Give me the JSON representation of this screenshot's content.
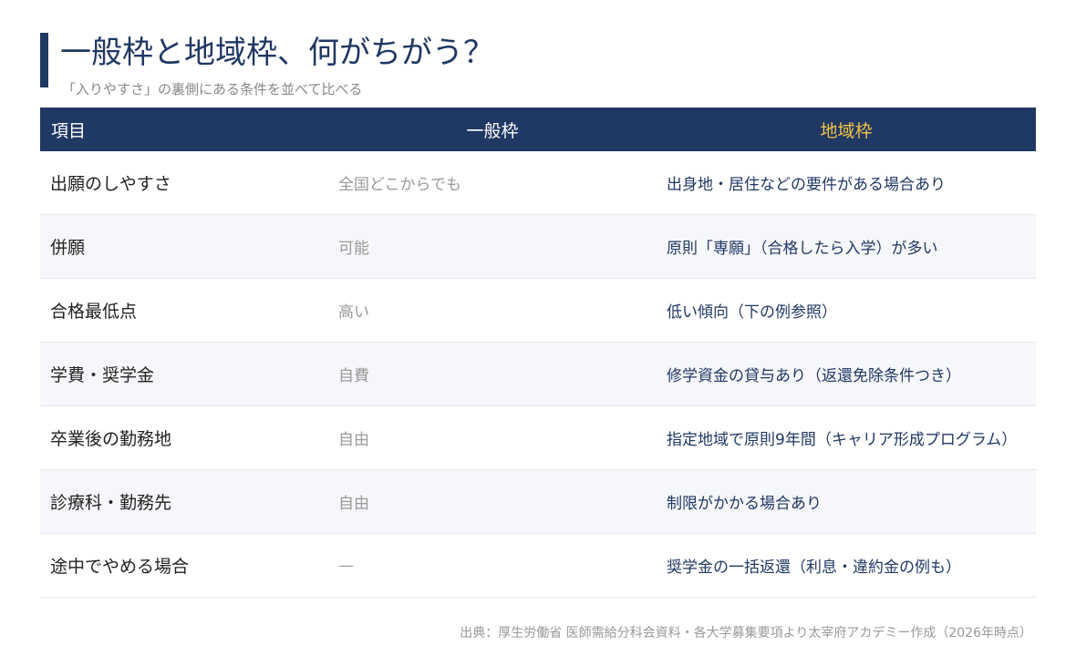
{
  "header": {
    "title": "一般枠と地域枠、何がちがう？",
    "subtitle": "「入りやすさ」の裏側にある条件を並べて比べる"
  },
  "table": {
    "columns": [
      "項目",
      "一般枠",
      "地域枠"
    ],
    "rows": [
      [
        "出願のしやすさ",
        "全国どこからでも",
        "出身地・居住などの要件がある場合あり"
      ],
      [
        "併願",
        "可能",
        "原則「専願」（合格したら入学）が多い"
      ],
      [
        "合格最低点",
        "高い",
        "低い傾向（下の例参照）"
      ],
      [
        "学費・奨学金",
        "自費",
        "修学資金の貸与あり（返還免除条件つき）"
      ],
      [
        "卒業後の勤務地",
        "自由",
        "指定地域で原則9年間（キャリア形成プログラム）"
      ],
      [
        "診療科・勤務先",
        "自由",
        "制限がかかる場合あり"
      ],
      [
        "途中でやめる場合",
        "—",
        "奨学金の一括返還（利息・違約金の例も）"
      ]
    ]
  },
  "footer": {
    "source": "出典：厚生労働省 医師需給分科会資料・各大学募集要項より太宰府アカデミー作成（2026年時点）"
  },
  "colors": {
    "navy": "#1f3864",
    "gold": "#f5c542",
    "row_alt": "#f6f7fa"
  }
}
